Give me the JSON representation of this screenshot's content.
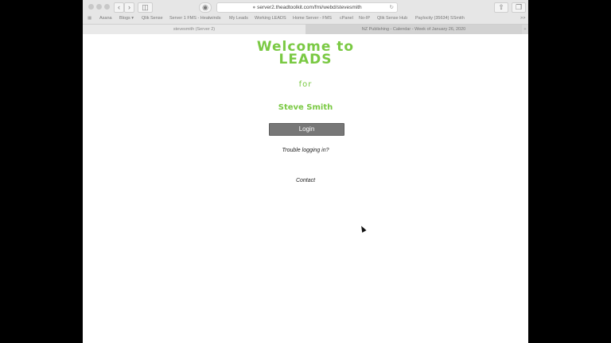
{
  "browser": {
    "url": "server2.theadtoolkit.com/fmi/webd/stevesmith",
    "bookmarks": [
      "Asana",
      "Blogs",
      "Qlik Sense",
      "Server 1 FMS - Heatwinds",
      "My Leads",
      "Working LEADS",
      "Home Server - FMS",
      "cPanel",
      "No-IP",
      "Qlik Sense Hub",
      "Paylocity (35634) SSmith"
    ],
    "overflow": ">>",
    "tabs": [
      {
        "title": "stevesmith (Server 2)",
        "active": true
      },
      {
        "title": "NZ Publishing - Calendar - Week of January 26, 2020",
        "active": false
      }
    ]
  },
  "page": {
    "title_line1": "Welcome to",
    "title_line2": "LEADS",
    "for_text": "for",
    "user_name": "Steve Smith",
    "login_label": "Login",
    "trouble_link": "Trouble logging in?",
    "contact_link": "Contact"
  },
  "colors": {
    "accent_green": "#7ac943",
    "button_gray": "#777777"
  }
}
